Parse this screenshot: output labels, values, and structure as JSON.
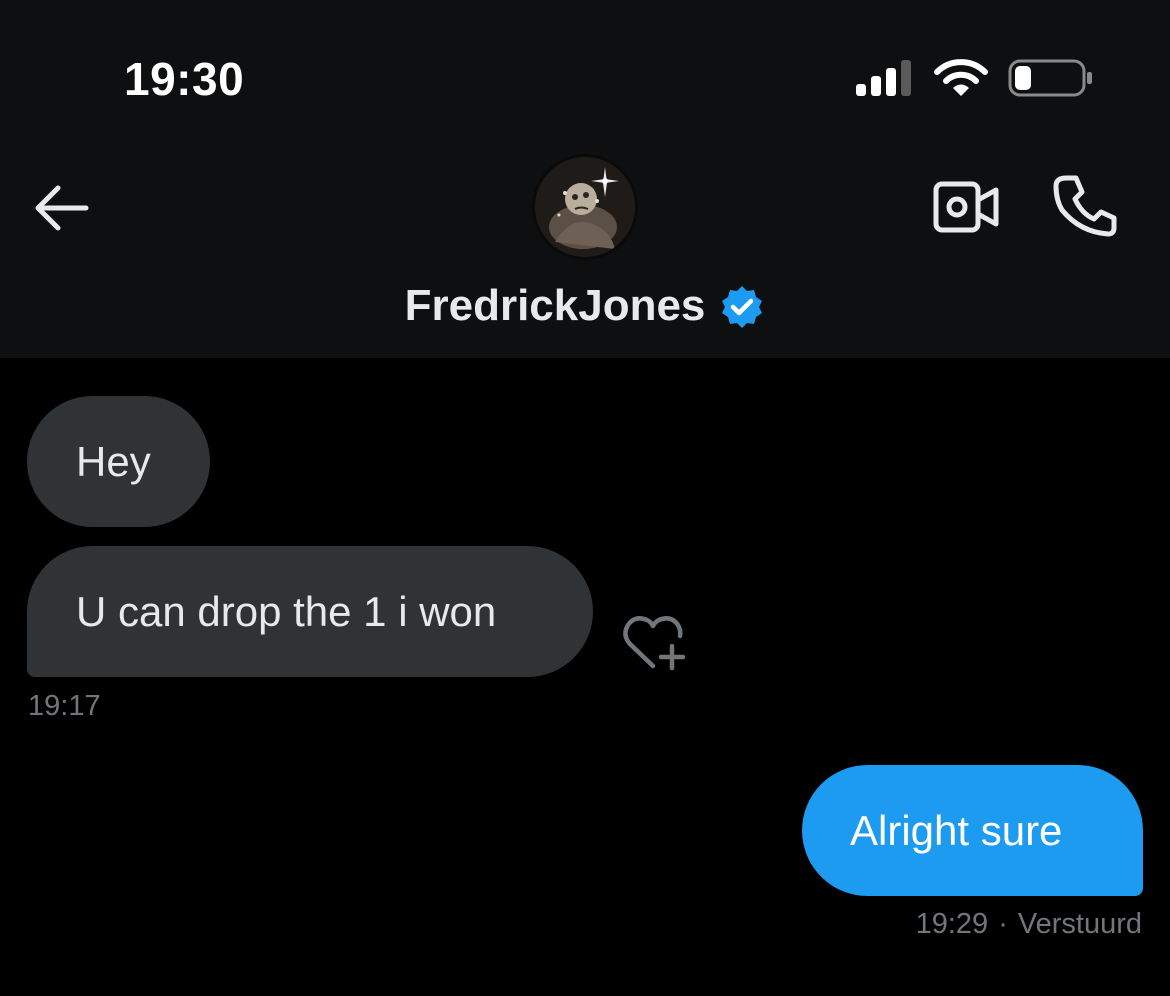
{
  "status_bar": {
    "time": "19:30",
    "icons": [
      "signal-icon",
      "wifi-icon",
      "battery-icon"
    ]
  },
  "header": {
    "back_icon": "arrow-left-icon",
    "contact_name": "FredrickJones",
    "verified": true,
    "video_icon": "video-camera-icon",
    "phone_icon": "phone-icon"
  },
  "messages": [
    {
      "direction": "incoming",
      "text": "Hey"
    },
    {
      "direction": "incoming",
      "text": "U can drop the 1 i won"
    }
  ],
  "incoming_timestamp": "19:17",
  "outgoing_message": {
    "text": "Alright sure",
    "time": "19:29",
    "separator": "·",
    "status": "Verstuurd"
  },
  "colors": {
    "accent": "#1d9bf0",
    "incoming_bubble": "#2f3336",
    "background": "#000000",
    "header_background": "#0e0f10",
    "muted_text": "#71767b"
  }
}
